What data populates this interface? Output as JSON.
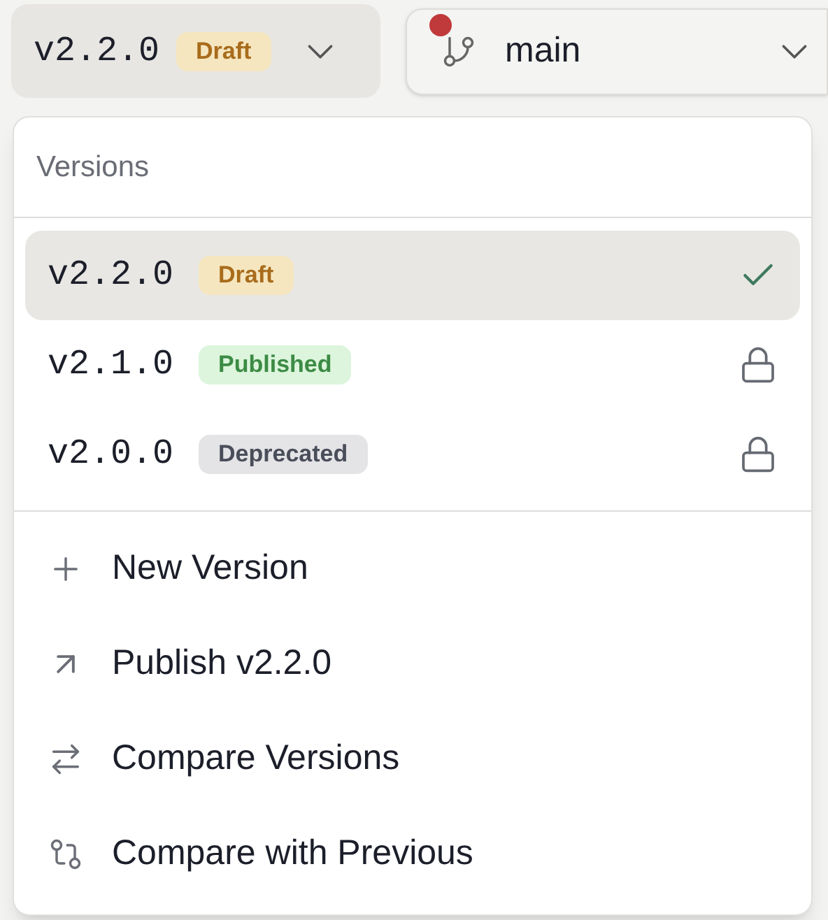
{
  "version_button": {
    "version": "v2.2.0",
    "status": {
      "label": "Draft",
      "kind": "draft"
    }
  },
  "branch_button": {
    "label": "main",
    "alert": true
  },
  "menu": {
    "header": "Versions",
    "versions": [
      {
        "version": "v2.2.0",
        "status": {
          "label": "Draft",
          "kind": "draft"
        },
        "selected": true,
        "locked": false
      },
      {
        "version": "v2.1.0",
        "status": {
          "label": "Published",
          "kind": "published"
        },
        "selected": false,
        "locked": true
      },
      {
        "version": "v2.0.0",
        "status": {
          "label": "Deprecated",
          "kind": "deprecated"
        },
        "selected": false,
        "locked": true
      }
    ],
    "actions": [
      {
        "label": "New Version",
        "kind": "new"
      },
      {
        "label": "Publish v2.2.0",
        "kind": "publish"
      },
      {
        "label": "Compare Versions",
        "kind": "compare"
      },
      {
        "label": "Compare with Previous",
        "kind": "compare-previous"
      }
    ]
  }
}
